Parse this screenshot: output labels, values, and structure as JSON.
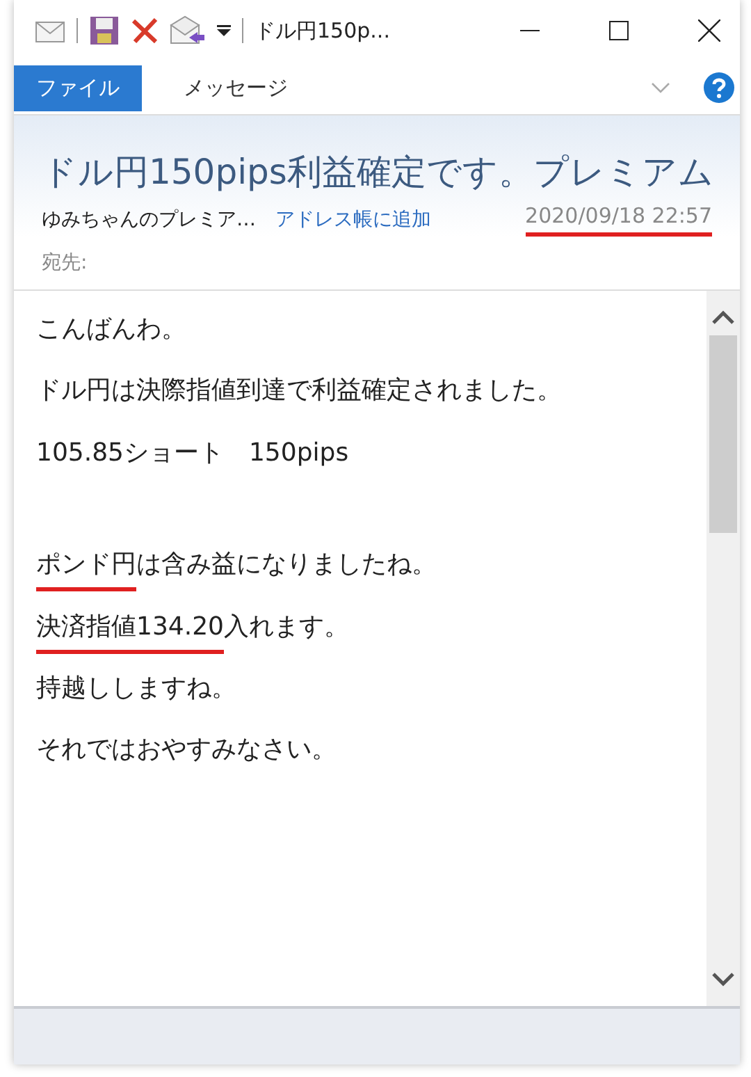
{
  "window": {
    "title": "ドル円150p..."
  },
  "tabs": [
    {
      "label": "ファイル",
      "selected": true
    },
    {
      "label": "メッセージ",
      "selected": false
    }
  ],
  "header": {
    "subject": "ドル円150pips利益確定です。プレミアム",
    "sender": "ゆみちゃんのプレミア…",
    "add_contact": "アドレス帳に追加",
    "date": "2020/09/18 22:57",
    "date_marked": true,
    "to_label": "宛先:"
  },
  "body": [
    {
      "segments": [
        {
          "text": "こんばんわ。",
          "marked": false
        }
      ]
    },
    {
      "segments": [
        {
          "text": "ドル円は決際指値到達で利益確定されました。",
          "marked": false
        }
      ]
    },
    {
      "segments": [
        {
          "text": "105.85ショート　150pips",
          "marked": false
        }
      ]
    },
    {
      "segments": [
        {
          "text": "ポンド円",
          "marked": true
        },
        {
          "text": "は含み益になりましたね。",
          "marked": false
        }
      ],
      "gap_before": true
    },
    {
      "segments": [
        {
          "text": "決済指値134.20",
          "marked": true
        },
        {
          "text": "入れます。",
          "marked": false
        }
      ]
    },
    {
      "segments": [
        {
          "text": "持越ししますね。",
          "marked": false
        }
      ]
    },
    {
      "segments": [
        {
          "text": "それではおやすみなさい。",
          "marked": false
        }
      ]
    }
  ]
}
